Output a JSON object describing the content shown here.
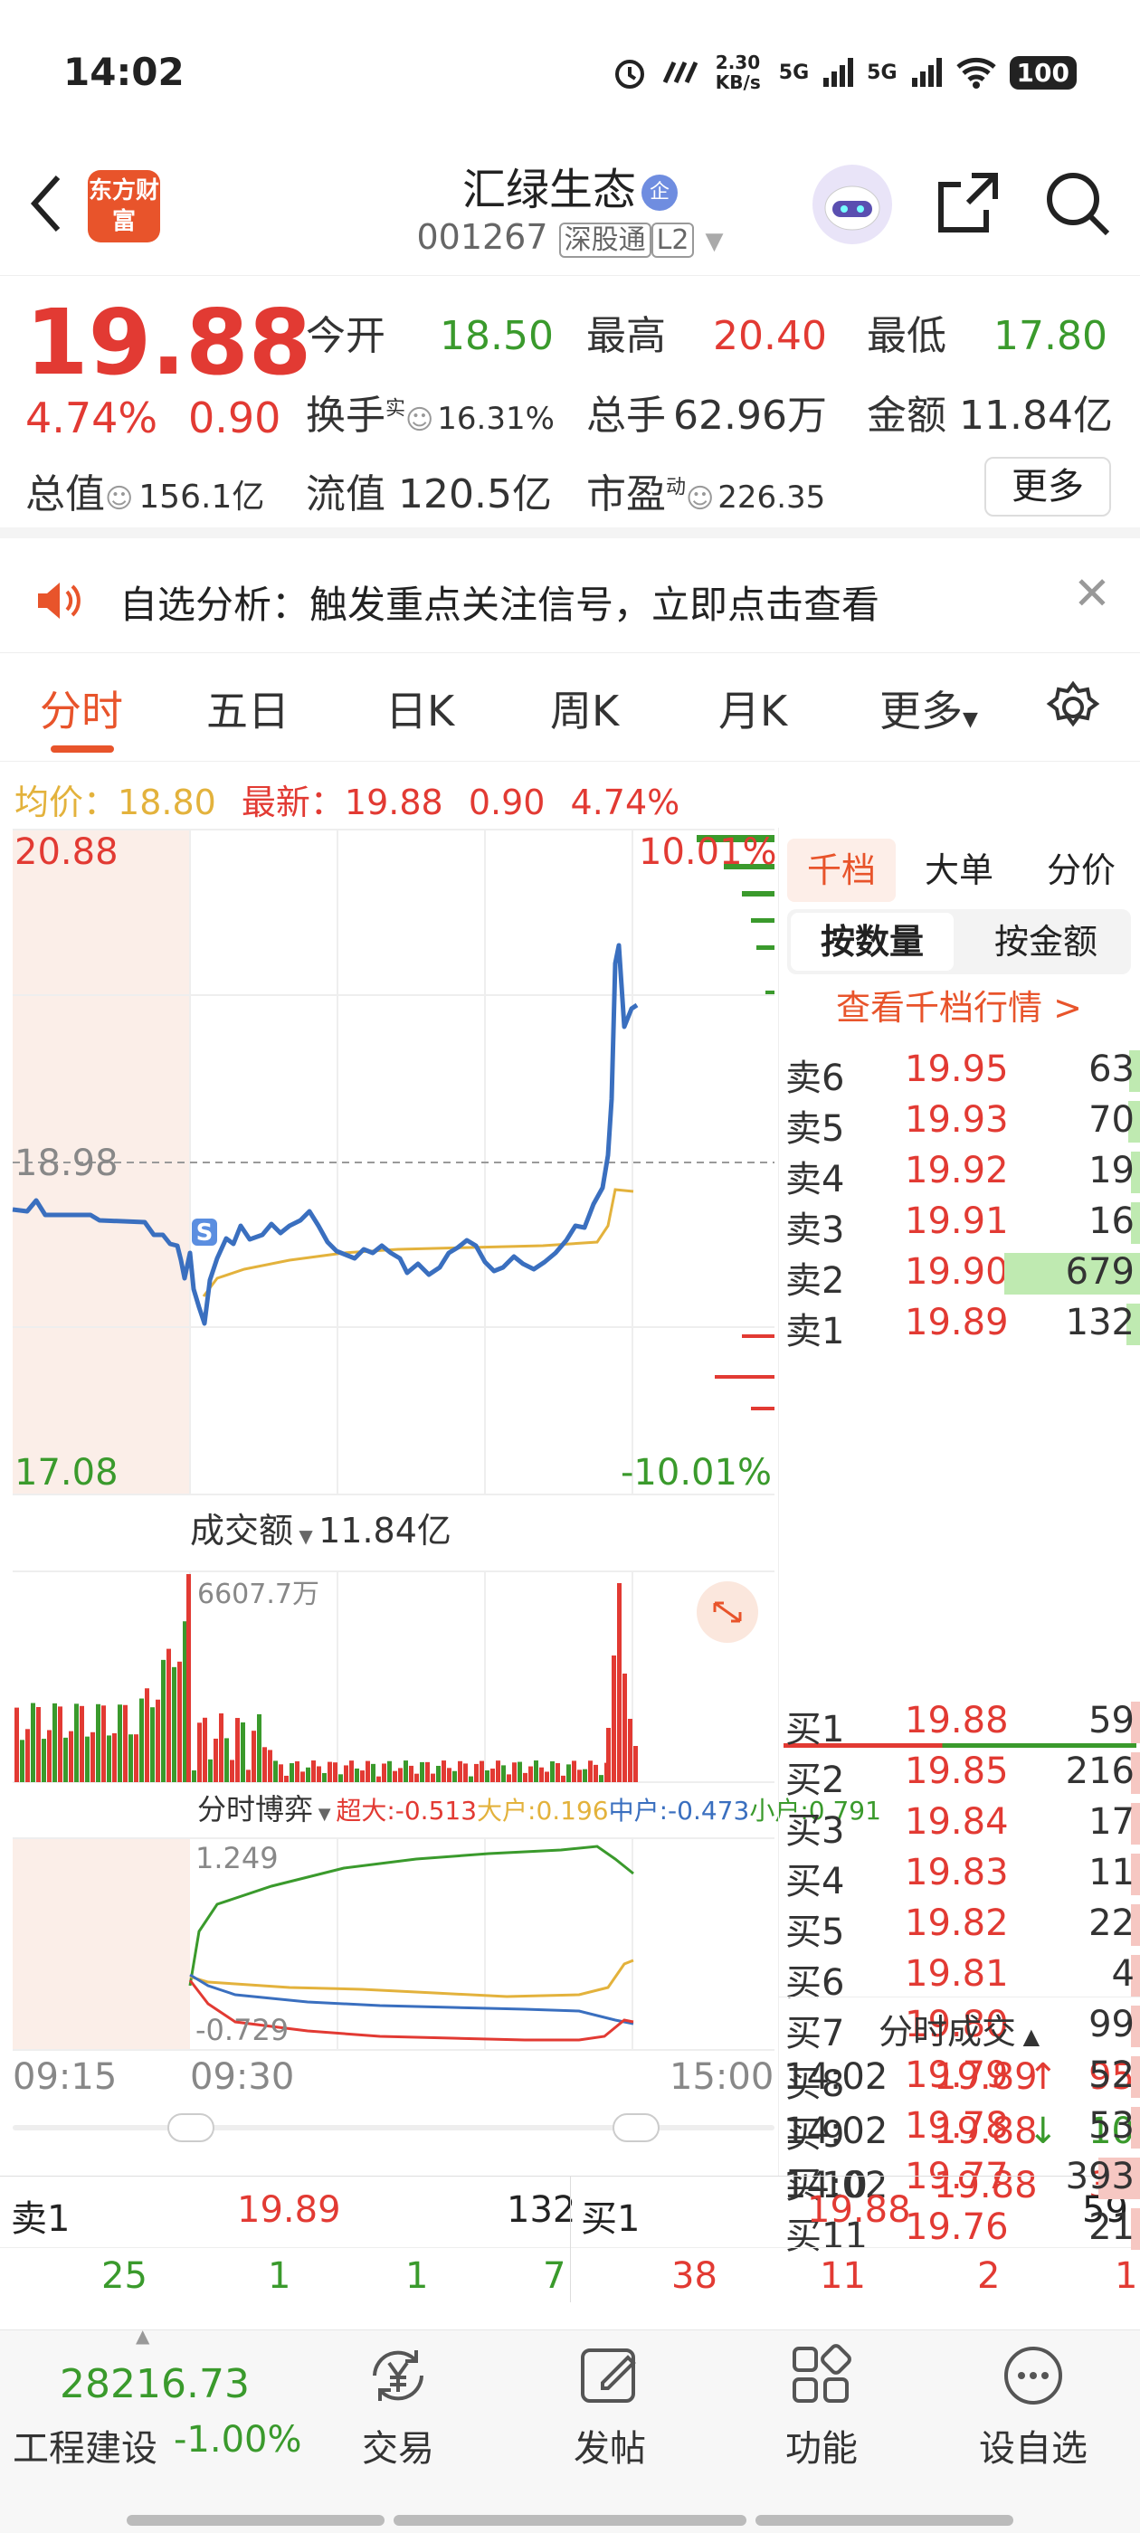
{
  "status_bar": {
    "time": "14:02",
    "net_speed": "2.30 KB/s",
    "signal1": "5G",
    "signal2": "5G",
    "battery": "100"
  },
  "header": {
    "logo_text": "东方财富",
    "stock_name": "汇绿生态",
    "badge": "企",
    "code": "001267",
    "tag1": "深股通",
    "tag2": "L2"
  },
  "quote": {
    "price": "19.88",
    "change_pct": "4.74%",
    "change": "0.90",
    "open_label": "今开",
    "open": "18.50",
    "high_label": "最高",
    "high": "20.40",
    "low_label": "最低",
    "low": "17.80",
    "turnover_label": "换手",
    "turnover_sup": "实",
    "turnover": "16.31%",
    "volume_label": "总手",
    "volume": "62.96万",
    "amount_label": "金额",
    "amount": "11.84亿",
    "mcap_label": "总值",
    "mcap": "156.1亿",
    "float_label": "流值",
    "float": "120.5亿",
    "pe_label": "市盈",
    "pe_sup": "动",
    "pe": "226.35",
    "more": "更多"
  },
  "alert": {
    "text": "自选分析：触发重点关注信号，立即点击查看"
  },
  "tabs": [
    {
      "label": "分时"
    },
    {
      "label": "五日"
    },
    {
      "label": "日K"
    },
    {
      "label": "周K"
    },
    {
      "label": "月K"
    },
    {
      "label": "更多"
    }
  ],
  "info_line": {
    "avg_label": "均价：",
    "avg": "18.80",
    "latest_label": "最新：",
    "latest": "19.88",
    "chg": "0.90",
    "pct": "4.74%"
  },
  "chart": {
    "y_top": "20.88",
    "y_mid": "18.98",
    "y_bot": "17.08",
    "pct_top": "10.01%",
    "pct_bot": "-10.01%",
    "s_badge": "S",
    "vol_label": "成交额",
    "vol_total": "11.84亿",
    "vol_max": "6607.7万",
    "game_label": "分时博弈",
    "game_big": "超大:-0.513",
    "game_large": "大户:0.196",
    "game_mid": "中户:-0.473",
    "game_small": "小户:0.791",
    "game_top": "1.249",
    "game_bot": "-0.729",
    "t_start": "09:15",
    "t_open": "09:30",
    "t_end": "15:00",
    "colors": {
      "price": "#3a6fbf",
      "avg": "#e3b23c",
      "up": "#e23a33",
      "down": "#3a9a2c"
    }
  },
  "orderbook": {
    "tabs": [
      "千档",
      "大单",
      "分价"
    ],
    "seg": [
      "按数量",
      "按金额"
    ],
    "link": "查看千档行情 >",
    "asks": [
      {
        "label": "卖6",
        "price": "19.95",
        "qty": "63",
        "bar": 0.08
      },
      {
        "label": "卖5",
        "price": "19.93",
        "qty": "70",
        "bar": 0.09
      },
      {
        "label": "卖4",
        "price": "19.92",
        "qty": "19",
        "bar": 0.03
      },
      {
        "label": "卖3",
        "price": "19.91",
        "qty": "16",
        "bar": 0.03
      },
      {
        "label": "卖2",
        "price": "19.90",
        "qty": "679",
        "bar": 1.0
      },
      {
        "label": "卖1",
        "price": "19.89",
        "qty": "132",
        "bar": 0.1
      }
    ],
    "bids": [
      {
        "label": "买1",
        "price": "19.88",
        "qty": "59",
        "bar": 0.06
      },
      {
        "label": "买2",
        "price": "19.85",
        "qty": "216",
        "bar": 0.13
      },
      {
        "label": "买3",
        "price": "19.84",
        "qty": "17",
        "bar": 0.03
      },
      {
        "label": "买4",
        "price": "19.83",
        "qty": "11",
        "bar": 0.02
      },
      {
        "label": "买5",
        "price": "19.82",
        "qty": "22",
        "bar": 0.03
      },
      {
        "label": "买6",
        "price": "19.81",
        "qty": "4",
        "bar": 0.01
      },
      {
        "label": "买7",
        "price": "19.80",
        "qty": "99",
        "bar": 0.05
      },
      {
        "label": "买8",
        "price": "19.79",
        "qty": "52",
        "bar": 0.04
      },
      {
        "label": "买9",
        "price": "19.78",
        "qty": "53",
        "bar": 0.04
      },
      {
        "label": "买10",
        "price": "19.77",
        "qty": "393",
        "bar": 0.58
      },
      {
        "label": "买11",
        "price": "19.76",
        "qty": "21",
        "bar": 0.03
      }
    ],
    "ticks_label": "分时成交",
    "ticks": [
      {
        "time": "14:02",
        "price": "19.89",
        "arrow": "↑",
        "qty": "95"
      },
      {
        "time": "14:02",
        "price": "19.88",
        "arrow": "↓",
        "qty": "10"
      },
      {
        "time": "14:02",
        "price": "19.88",
        "arrow": "",
        "qty": "33"
      }
    ]
  },
  "bottom_bands": {
    "sell1": "卖1",
    "sell1_price": "19.89",
    "sell1_qty": "132",
    "buy1": "买1",
    "buy1_price": "19.88",
    "buy1_qty": "59",
    "sell_orders": [
      "25",
      "1",
      "1",
      "7"
    ],
    "buy_orders": [
      "38",
      "11",
      "2",
      "1"
    ]
  },
  "bottom_nav": {
    "index_value": "28216.73",
    "index_name": "工程建设",
    "index_pct": "-1.00%",
    "items": [
      {
        "label": "交易"
      },
      {
        "label": "发帖"
      },
      {
        "label": "功能"
      },
      {
        "label": "设自选"
      }
    ]
  }
}
